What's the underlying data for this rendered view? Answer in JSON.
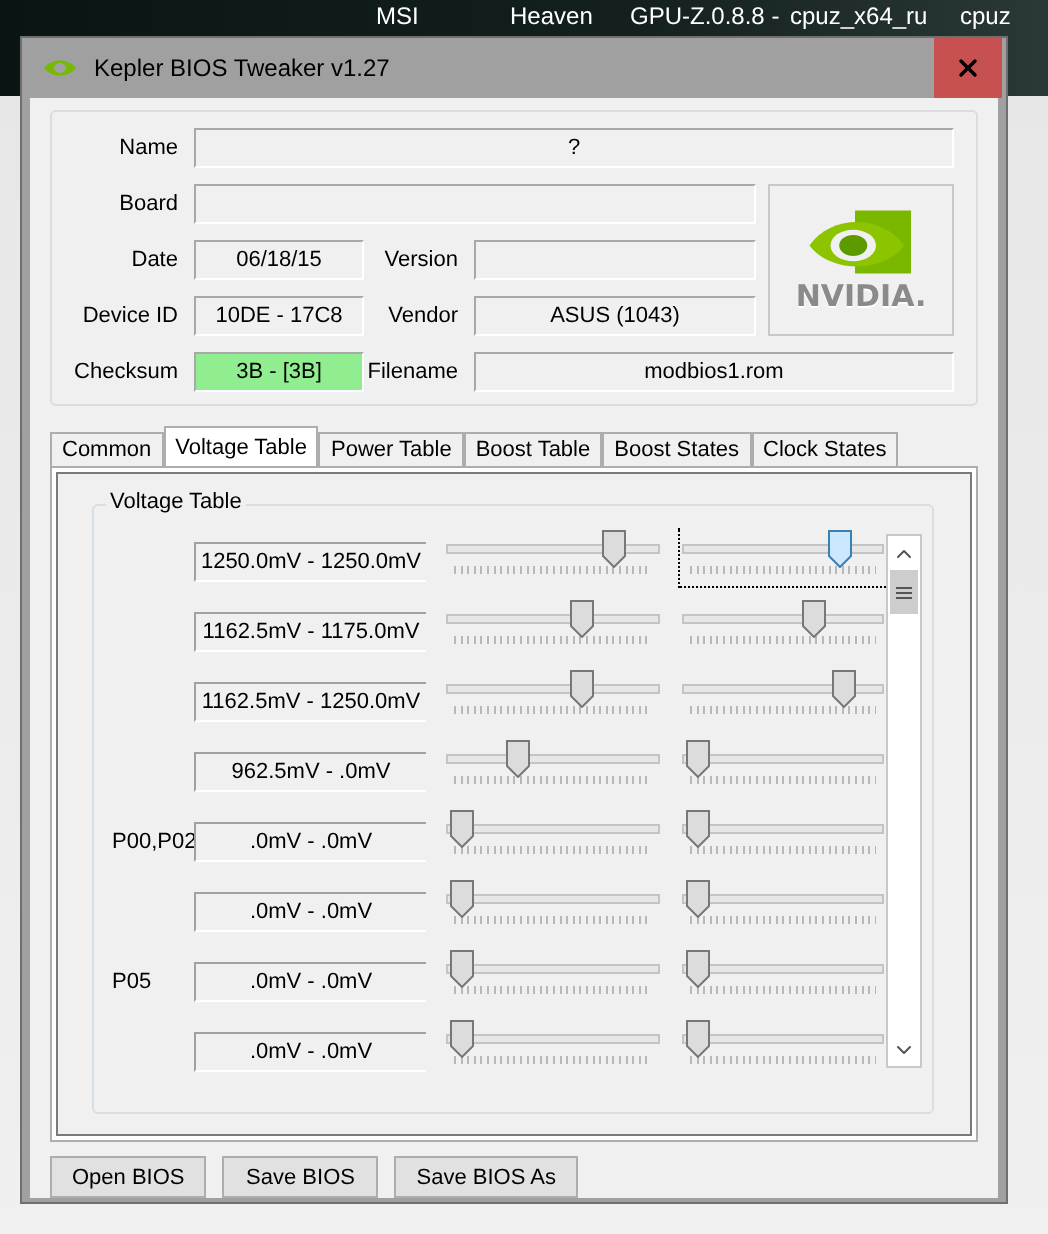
{
  "desktop": {
    "icons": [
      "MSI",
      "Heaven",
      "GPU-Z.0.8.8 -",
      "cpuz_x64_ru",
      "cpuz"
    ]
  },
  "window": {
    "title": "Kepler BIOS Tweaker v1.27"
  },
  "info": {
    "name": {
      "label": "Name",
      "value": "?"
    },
    "board": {
      "label": "Board"
    },
    "date": {
      "label": "Date",
      "value": "06/18/15"
    },
    "version": {
      "label": "Version"
    },
    "device_id": {
      "label": "Device ID",
      "value": "10DE - 17C8"
    },
    "vendor": {
      "label": "Vendor",
      "value": "ASUS (1043)"
    },
    "checksum": {
      "label": "Checksum",
      "value": "3B - [3B]",
      "valid": true
    },
    "filename": {
      "label": "Filename",
      "value": "modbios1.rom"
    },
    "logo_text": "NVIDIA."
  },
  "tabs": [
    {
      "label": "Common",
      "selected": false
    },
    {
      "label": "Voltage Table",
      "selected": true
    },
    {
      "label": "Power Table",
      "selected": false
    },
    {
      "label": "Boost Table",
      "selected": false
    },
    {
      "label": "Boost States",
      "selected": false
    },
    {
      "label": "Clock States",
      "selected": false
    }
  ],
  "voltage_table": {
    "title": "Voltage Table",
    "rows": [
      {
        "range": "1250.0mV - 1250.0mV",
        "sliders": [
          {
            "level": 0.83,
            "focused": false
          },
          {
            "level": 0.82,
            "focused": true
          }
        ]
      },
      {
        "range": "1162.5mV - 1175.0mV",
        "sliders": [
          {
            "level": 0.65,
            "focused": false
          },
          {
            "level": 0.68,
            "focused": false
          }
        ]
      },
      {
        "range": "1162.5mV - 1250.0mV",
        "sliders": [
          {
            "level": 0.65,
            "focused": false
          },
          {
            "level": 0.85,
            "focused": false
          }
        ]
      },
      {
        "range": "962.5mV - .0mV",
        "sliders": [
          {
            "level": 0.3,
            "focused": false
          },
          {
            "level": 0,
            "focused": false
          }
        ]
      },
      {
        "label": "P00,P02",
        "range": ".0mV - .0mV",
        "sliders": [
          {
            "level": 0,
            "focused": false
          },
          {
            "level": 0,
            "focused": false
          }
        ]
      },
      {
        "range": ".0mV - .0mV",
        "sliders": [
          {
            "level": 0,
            "focused": false
          },
          {
            "level": 0,
            "focused": false
          }
        ]
      },
      {
        "label": "P05",
        "range": ".0mV - .0mV",
        "sliders": [
          {
            "level": 0,
            "focused": false
          },
          {
            "level": 0,
            "focused": false
          }
        ]
      },
      {
        "range": ".0mV - .0mV",
        "sliders": [
          {
            "level": 0,
            "focused": false
          },
          {
            "level": 0,
            "focused": false
          }
        ]
      }
    ]
  },
  "buttons": [
    "Open BIOS",
    "Save BIOS",
    "Save BIOS As"
  ]
}
